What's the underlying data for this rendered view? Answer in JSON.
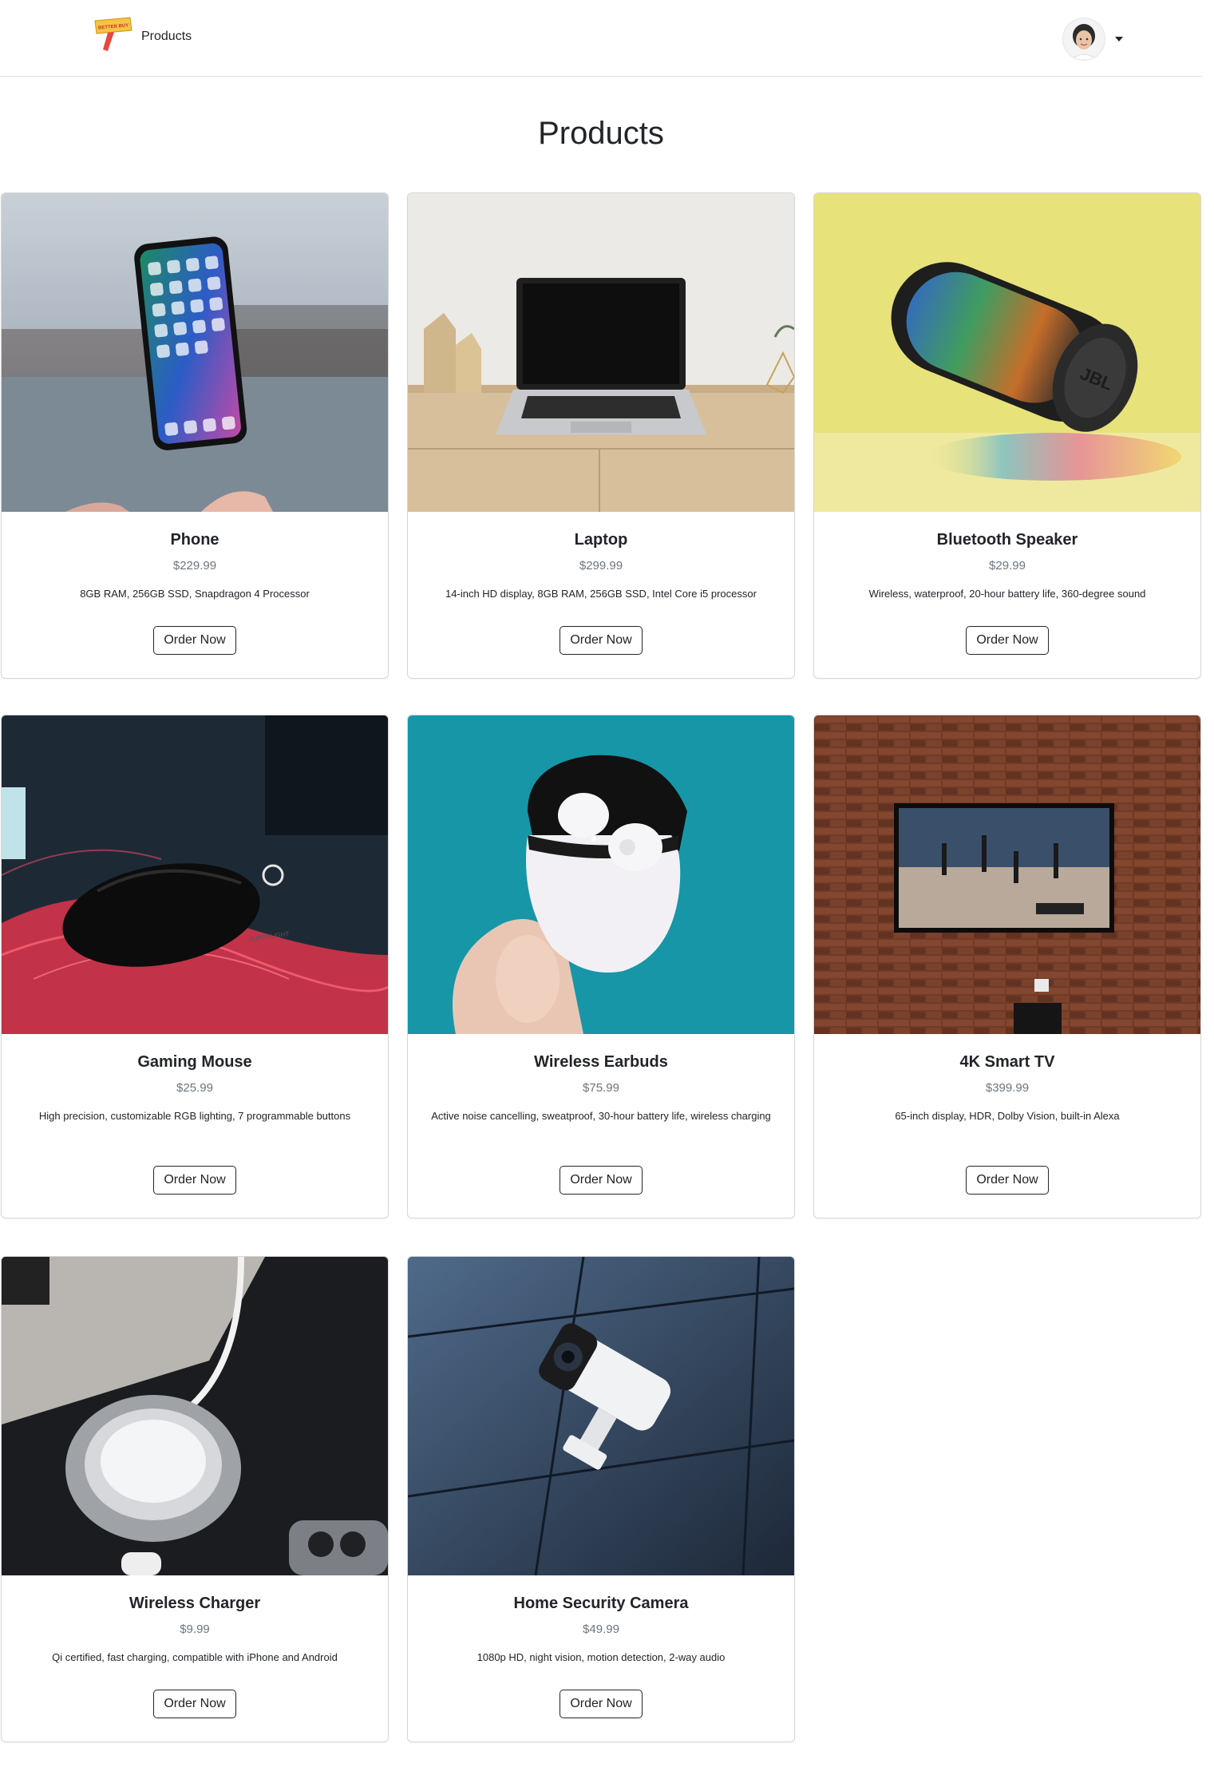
{
  "nav": {
    "brand_label": "Products",
    "logo_text": "BETTER BUY",
    "logo_icon": "price-tag-sign-logo",
    "avatar_icon": "user-avatar",
    "dropdown_icon": "caret-down-icon"
  },
  "page": {
    "title": "Products"
  },
  "order_button_label": "Order Now",
  "products": [
    {
      "name": "Phone",
      "price": "$229.99",
      "description": "8GB RAM, 256GB SSD, Snapdragon 4 Processor",
      "image": "smartphone-photo"
    },
    {
      "name": "Laptop",
      "price": "$299.99",
      "description": "14-inch HD display, 8GB RAM, 256GB SSD, Intel Core i5 processor",
      "image": "laptop-photo"
    },
    {
      "name": "Bluetooth Speaker",
      "price": "$29.99",
      "description": "Wireless, waterproof, 20-hour battery life, 360-degree sound",
      "image": "speaker-photo",
      "image_text": "JBL"
    },
    {
      "name": "Gaming Mouse",
      "price": "$25.99",
      "description": "High precision, customizable RGB lighting, 7 programmable buttons",
      "image": "gaming-mouse-photo",
      "image_text": "SUPERLIGHT"
    },
    {
      "name": "Wireless Earbuds",
      "price": "$75.99",
      "description": "Active noise cancelling, sweatproof, 30-hour battery life, wireless charging",
      "image": "earbuds-photo"
    },
    {
      "name": "4K Smart TV",
      "price": "$399.99",
      "description": "65-inch display, HDR, Dolby Vision, built-in Alexa",
      "image": "smart-tv-photo"
    },
    {
      "name": "Wireless Charger",
      "price": "$9.99",
      "description": "Qi certified, fast charging, compatible with iPhone and Android",
      "image": "wireless-charger-photo"
    },
    {
      "name": "Home Security Camera",
      "price": "$49.99",
      "description": "1080p HD, night vision, motion detection, 2-way audio",
      "image": "security-camera-photo"
    }
  ],
  "colors": {
    "text": "#212529",
    "muted": "#6c757d",
    "border": "#dee2e6",
    "logo_yellow": "#f6c343",
    "logo_red": "#e8473c"
  }
}
